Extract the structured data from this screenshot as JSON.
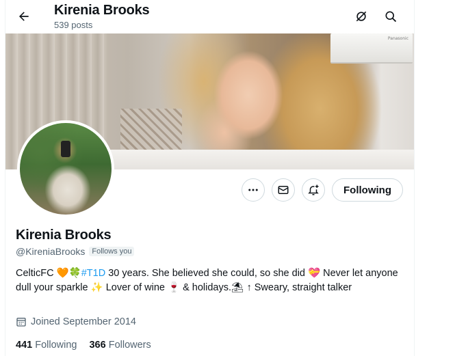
{
  "header": {
    "name": "Kirenia Brooks",
    "posts": "539 posts",
    "back_icon": "arrow-left-icon",
    "grok_icon": "grok-icon",
    "search_icon": "search-icon"
  },
  "banner": {
    "ac_brand": "Panasonic"
  },
  "profile": {
    "name": "Kirenia Brooks",
    "handle": "@KireniaBrooks",
    "follows_you": "Follows you",
    "bio": {
      "p1": "CelticFC ",
      "e1": "🧡🍀",
      "hashtag": "#T1D",
      "p2": " 30 years. She believed she could, so she did ",
      "e2": "💝",
      "p3": " Never let anyone dull your sparkle ",
      "e3": "✨",
      "p4": " Lover of wine ",
      "e4": "🍷",
      "p5": " & holidays.",
      "e5": "⛱",
      "p6": "↑ Sweary, straight talker"
    },
    "joined": "Joined September 2014",
    "following_count": "441",
    "following_label": "Following",
    "followers_count": "366",
    "followers_label": "Followers"
  },
  "actions": {
    "more_icon": "more-icon",
    "message_icon": "message-icon",
    "notify_icon": "bell-plus-icon",
    "following_button": "Following"
  },
  "colors": {
    "accent": "#1d9bf0",
    "text": "#0f1419",
    "muted": "#536471",
    "border": "#cfd9de"
  }
}
